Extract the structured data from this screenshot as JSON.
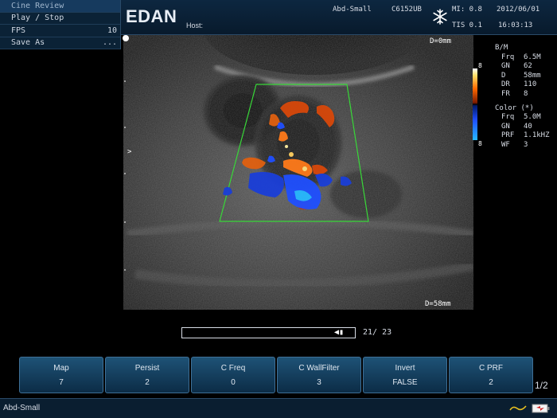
{
  "cine_menu": {
    "title": "Cine Review",
    "items": [
      {
        "label": "Play / Stop",
        "value": ""
      },
      {
        "label": "FPS",
        "value": "10"
      },
      {
        "label": "Save As",
        "value": "..."
      }
    ]
  },
  "header": {
    "logo": "EDAN",
    "host_label": "Host:",
    "preset": "Abd-Small",
    "probe": "C6152UB",
    "mi": "MI: 0.8",
    "tis": "TIS 0.1",
    "date": "2012/06/01",
    "time": "16:03:13",
    "freeze_icon": "snowflake-icon"
  },
  "image": {
    "depth_top": "D=0mm",
    "depth_bottom": "D=58mm",
    "side_marker": ">"
  },
  "color_bar": {
    "top_label": "8",
    "bottom_label": "8"
  },
  "params": {
    "bm_title": "B/M",
    "bm": [
      {
        "k": "Frq",
        "v": "6.5M"
      },
      {
        "k": "GN",
        "v": "62"
      },
      {
        "k": "D",
        "v": "58mm"
      },
      {
        "k": "DR",
        "v": "110"
      },
      {
        "k": "FR",
        "v": "8"
      }
    ],
    "color_title": "Color (*)",
    "color": [
      {
        "k": "Frq",
        "v": "5.0M"
      },
      {
        "k": "GN",
        "v": "40"
      },
      {
        "k": "PRF",
        "v": "1.1kHZ"
      },
      {
        "k": "WF",
        "v": "3"
      }
    ]
  },
  "cine": {
    "frame_counter": "21/ 23",
    "current_frame": 21,
    "total_frames": 23
  },
  "softkeys": [
    {
      "label": "Map",
      "value": "7"
    },
    {
      "label": "Persist",
      "value": "2"
    },
    {
      "label": "C Freq",
      "value": "0"
    },
    {
      "label": "C WallFilter",
      "value": "3"
    },
    {
      "label": "Invert",
      "value": "FALSE"
    },
    {
      "label": "C PRF",
      "value": "2"
    }
  ],
  "page_indicator": "1/2",
  "status": {
    "preset": "Abd-Small",
    "icons": [
      "wave-icon",
      "battery-icon"
    ]
  }
}
